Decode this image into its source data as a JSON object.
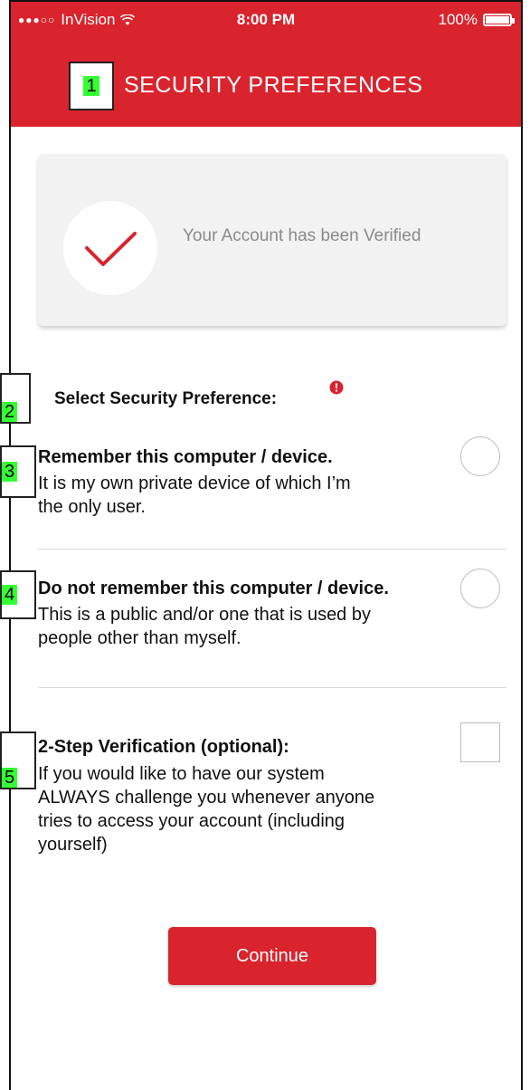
{
  "status_bar": {
    "signal_dots": "●●●○○",
    "carrier": "InVision",
    "time": "8:00 PM",
    "battery": "100%"
  },
  "header": {
    "title": "SECURITY PREFERENCES"
  },
  "annotations": [
    "1",
    "2",
    "3",
    "4",
    "5"
  ],
  "verified_card": {
    "message": "Your Account has been Verified"
  },
  "preference_section": {
    "title": "Select Security Preference:"
  },
  "options": [
    {
      "title": "Remember this computer / device.",
      "desc_lines": [
        "It is my own private device of which I’m",
        "the only user."
      ],
      "selected": false
    },
    {
      "title": "Do not remember this computer / device.",
      "desc_lines": [
        "This is a public and/or one that is used by",
        "people other than myself."
      ],
      "selected": false
    }
  ],
  "two_step": {
    "title": "2-Step Verification (optional):",
    "desc_lines": [
      "If you would like to have our system",
      "ALWAYS challenge you whenever anyone",
      "tries to access your account (including",
      "yourself)"
    ],
    "checked": false
  },
  "continue_label": "Continue",
  "colors": {
    "brand_red": "#d9232d",
    "card_bg": "#f2f2f2",
    "muted_text": "#8a8a8a",
    "annotation_green": "#33ff33"
  },
  "icons": {
    "check": "check-icon",
    "info": "info-icon",
    "wifi": "wifi-icon",
    "battery": "battery-icon"
  }
}
